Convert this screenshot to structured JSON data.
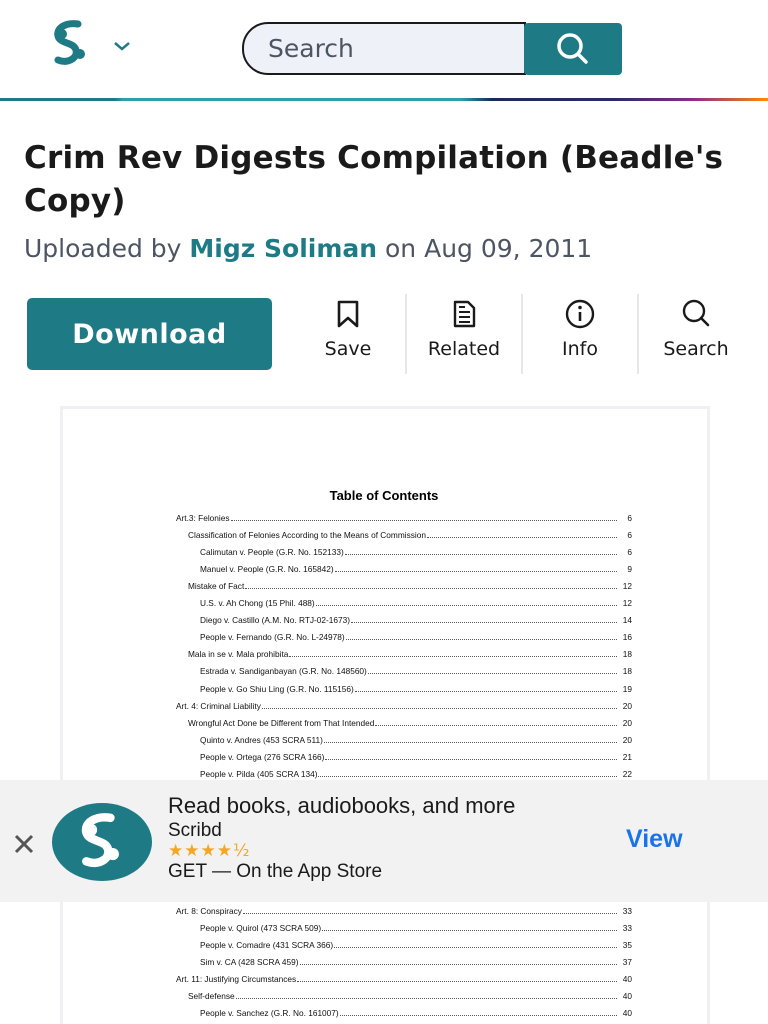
{
  "header": {
    "logo_icon": "scribd-logo-icon",
    "menu_icon": "chevron-down-icon",
    "search_placeholder": "Search",
    "search_button_icon": "search-icon",
    "accent": "#1e7b85"
  },
  "document": {
    "title": "Crim Rev Digests Compilation (Beadle's Copy)",
    "uploaded_prefix": "Uploaded by",
    "author": "Migz Soliman",
    "date_text": "on Aug 09, 2011"
  },
  "actions": {
    "download_label": "Download",
    "save_label": "Save",
    "related_label": "Related",
    "info_label": "Info",
    "search_label": "Search"
  },
  "toc": {
    "heading": "Table of Contents",
    "entries_top": [
      {
        "text": "Art.3: Felonies",
        "page": "6",
        "level": 0
      },
      {
        "text": "Classification of Felonies According to the Means of Commission",
        "page": "6",
        "level": 1
      },
      {
        "text": "Calimutan v. People (G.R. No. 152133)",
        "page": "6",
        "level": 2
      },
      {
        "text": "Manuel v. People (G.R. No. 165842)",
        "page": "9",
        "level": 2
      },
      {
        "text": "Mistake of Fact",
        "page": "12",
        "level": 1
      },
      {
        "text": "U.S. v. Ah Chong (15 Phil. 488)",
        "page": "12",
        "level": 2
      },
      {
        "text": "Diego v. Castillo (A.M. No. RTJ-02-1673)",
        "page": "14",
        "level": 2
      },
      {
        "text": "People v. Fernando (G.R. No. L-24978)",
        "page": "16",
        "level": 2
      },
      {
        "text": "Mala in se v. Mala prohibita",
        "page": "18",
        "level": 1
      },
      {
        "text": "Estrada v. Sandiganbayan (G.R. No. 148560)",
        "page": "18",
        "level": 2
      },
      {
        "text": "People v. Go Shiu Ling (G.R. No. 115156)",
        "page": "19",
        "level": 2
      },
      {
        "text": "Art. 4: Criminal Liability",
        "page": "20",
        "level": 0
      },
      {
        "text": "Wrongful Act Done be Different from That Intended",
        "page": "20",
        "level": 1
      },
      {
        "text": "Quinto v. Andres (453 SCRA 511)",
        "page": "20",
        "level": 2
      },
      {
        "text": "People v. Ortega (276 SCRA 166)",
        "page": "21",
        "level": 2
      },
      {
        "text": "People v. Pilda (405 SCRA 134)",
        "page": "22",
        "level": 2
      }
    ],
    "entries_bottom": [
      {
        "text": "Art. 8: Conspiracy",
        "page": "33",
        "level": 0
      },
      {
        "text": "People v. Quirol (473 SCRA 509)",
        "page": "33",
        "level": 2
      },
      {
        "text": "People v. Comadre (431 SCRA 366)",
        "page": "35",
        "level": 2
      },
      {
        "text": "Sim v. CA (428 SCRA 459)",
        "page": "37",
        "level": 2
      },
      {
        "text": "Art. 11: Justifying Circumstances",
        "page": "40",
        "level": 0
      },
      {
        "text": "Self-defense",
        "page": "40",
        "level": 1
      },
      {
        "text": "People v. Sanchez (G.R. No. 161007)",
        "page": "40",
        "level": 2
      }
    ]
  },
  "app_banner": {
    "close_icon": "close-icon",
    "tagline": "Read books, audiobooks, and more",
    "app_name": "Scribd",
    "rating_stars": "★★★★½",
    "store_text": "GET — On the App Store",
    "view_label": "View",
    "view_color": "#1a73e8",
    "star_color": "#f5a623"
  }
}
